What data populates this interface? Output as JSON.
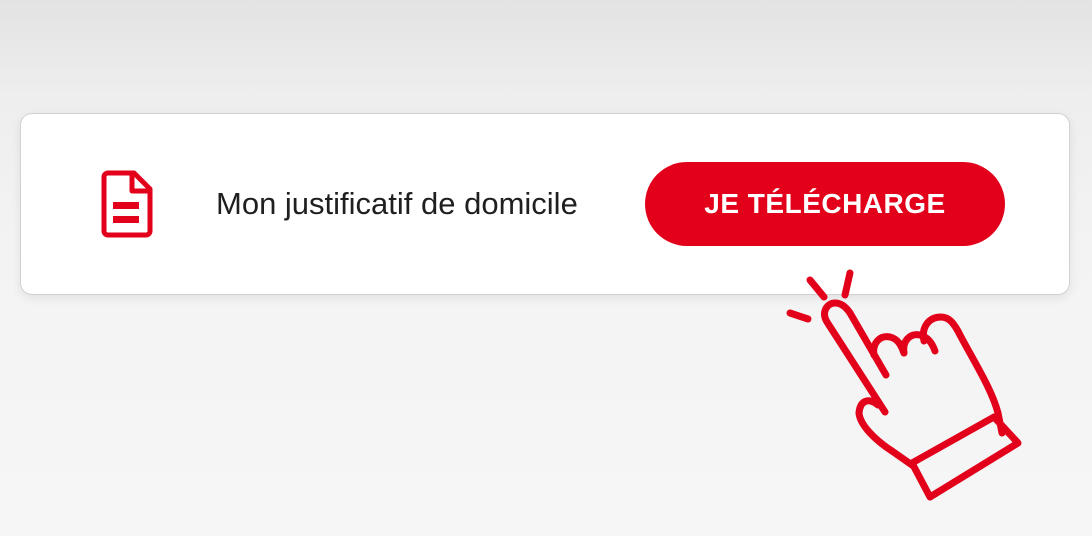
{
  "document_row": {
    "label": "Mon justificatif de domicile",
    "icon": "document-icon"
  },
  "download_button": {
    "label": "JE TÉLÉCHARGE"
  },
  "pointer": {
    "icon": "hand-pointer-click-icon"
  },
  "colors": {
    "accent": "#e2001a",
    "card_background": "#ffffff",
    "text": "#1f1f1f"
  }
}
